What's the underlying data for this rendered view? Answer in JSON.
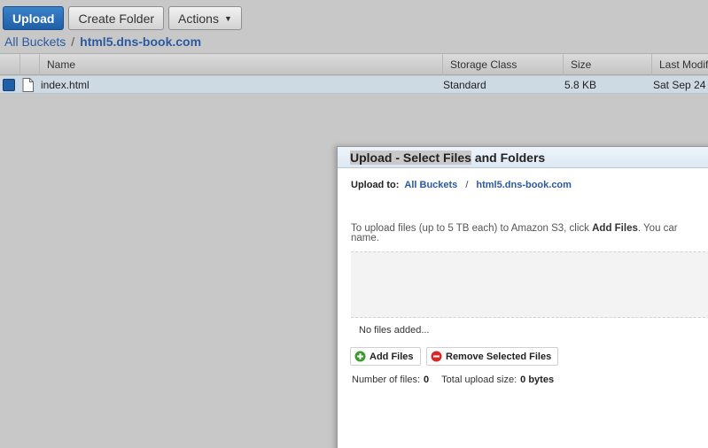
{
  "toolbar": {
    "upload_label": "Upload",
    "create_folder_label": "Create Folder",
    "actions_label": "Actions"
  },
  "breadcrumb": {
    "root": "All Buckets",
    "separator": "/",
    "current": "html5.dns-book.com"
  },
  "table": {
    "columns": [
      "Name",
      "Storage Class",
      "Size",
      "Last Modif"
    ],
    "rows": [
      {
        "name": "index.html",
        "storage_class": "Standard",
        "size": "5.8 KB",
        "last_modified": "Sat Sep 24 1"
      }
    ]
  },
  "modal": {
    "title_highlight": "Upload - Select Files",
    "title_rest": " and Folders",
    "upload_to_label": "Upload to:",
    "upload_to_root": "All Buckets",
    "upload_to_separator": "/",
    "upload_to_bucket": "html5.dns-book.com",
    "instructions_pre": "To upload files (up to 5 TB each) to Amazon S3, click ",
    "instructions_bold": "Add Files",
    "instructions_post": ". You car",
    "instructions_line2": "name.",
    "no_files_text": "No files added...",
    "add_files_label": "Add Files",
    "remove_selected_label": "Remove Selected Files",
    "number_of_files_label": "Number of files:",
    "number_of_files_value": "0",
    "total_size_label": "Total upload size:",
    "total_size_value": "0 bytes"
  },
  "colors": {
    "primary_button": "#1f5fa8",
    "link": "#2b5aa0",
    "selected_row": "#cdd9e3",
    "add_icon": "#3a9a2e",
    "remove_icon": "#d62828"
  },
  "icons": {
    "caret": "chevron-down-icon",
    "file": "file-icon",
    "add": "plus-circle-icon",
    "remove": "minus-circle-icon"
  }
}
